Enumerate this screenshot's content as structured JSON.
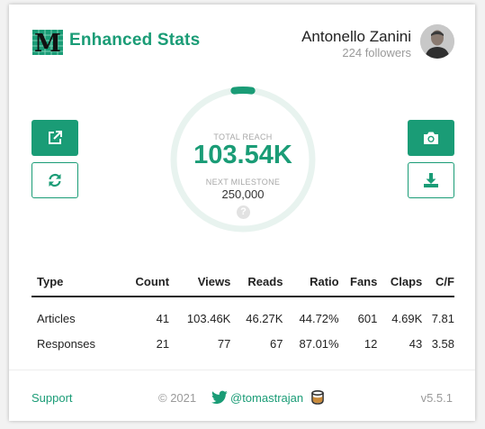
{
  "header": {
    "app_title": "Enhanced Stats",
    "user_name": "Antonello Zanini",
    "followers": "224 followers"
  },
  "buttons": {
    "open_icon": "external-link-icon",
    "refresh_icon": "refresh-icon",
    "screenshot_icon": "camera-icon",
    "download_icon": "download-icon"
  },
  "reach": {
    "label": "TOTAL REACH",
    "value": "103.54K",
    "milestone_label": "NEXT MILESTONE",
    "milestone_value": "250,000",
    "progress_percent": 4,
    "help": "?"
  },
  "table": {
    "headers": [
      "Type",
      "Count",
      "Views",
      "Reads",
      "Ratio",
      "Fans",
      "Claps",
      "C/F"
    ],
    "rows": [
      [
        "Articles",
        "41",
        "103.46K",
        "46.27K",
        "44.72%",
        "601",
        "4.69K",
        "7.81"
      ],
      [
        "Responses",
        "21",
        "77",
        "67",
        "87.01%",
        "12",
        "43",
        "3.58"
      ]
    ]
  },
  "footer": {
    "support": "Support",
    "copyright": "© 2021",
    "twitter_handle": "@tomastrajan",
    "version": "v5.5.1"
  },
  "colors": {
    "accent": "#1a9c76",
    "ring_track": "#e8f3ef",
    "muted": "#9a9a9a"
  }
}
